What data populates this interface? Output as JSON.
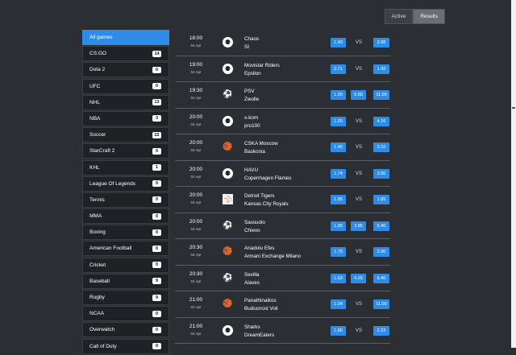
{
  "tabs": [
    {
      "label": "Active",
      "selected": false
    },
    {
      "label": "Results",
      "selected": true
    }
  ],
  "sidebar": [
    {
      "label": "All games",
      "count": "",
      "selected": true
    },
    {
      "label": "CS:GO",
      "count": "14"
    },
    {
      "label": "Dota 2",
      "count": "0"
    },
    {
      "label": "UFC",
      "count": "0"
    },
    {
      "label": "NHL",
      "count": "13"
    },
    {
      "label": "NBA",
      "count": "3"
    },
    {
      "label": "Soccer",
      "count": "22"
    },
    {
      "label": "StarCraft 2",
      "count": "0"
    },
    {
      "label": "KHL",
      "count": "1"
    },
    {
      "label": "League Of Legends",
      "count": "0"
    },
    {
      "label": "Tennis",
      "count": "0"
    },
    {
      "label": "MMA",
      "count": "0"
    },
    {
      "label": "Boxing",
      "count": "0"
    },
    {
      "label": "American Football",
      "count": "0"
    },
    {
      "label": "Cricket",
      "count": "0"
    },
    {
      "label": "Baseball",
      "count": "9"
    },
    {
      "label": "Rugby",
      "count": "9"
    },
    {
      "label": "NCAA",
      "count": "0"
    },
    {
      "label": "Overwatch",
      "count": "0"
    },
    {
      "label": "Call of Duty",
      "count": "0"
    }
  ],
  "matches": [
    {
      "time": "18:00",
      "date": "04 Apr",
      "icon": "cs-icon",
      "team1": "Chaos",
      "team2": "SI",
      "odd1": "1.43",
      "oddx": "",
      "odd2": "2.68"
    },
    {
      "time": "19:00",
      "date": "04 Apr",
      "icon": "cs-icon",
      "team1": "Movistar Riders",
      "team2": "Epsilon",
      "odd1": "2.71",
      "oddx": "",
      "odd2": "1.42"
    },
    {
      "time": "19:30",
      "date": "04 Apr",
      "icon": "soccer-icon",
      "team1": "PSV",
      "team2": "Zwolle",
      "odd1": "1.25",
      "oddx": "6.80",
      "odd2": "11.00"
    },
    {
      "time": "20:00",
      "date": "04 Apr",
      "icon": "cs-icon",
      "team1": "x-kom",
      "team2": "pro100",
      "odd1": "1.20",
      "oddx": "",
      "odd2": "4.16"
    },
    {
      "time": "20:00",
      "date": "04 Apr",
      "icon": "basketball-icon",
      "team1": "CSKA Moscow",
      "team2": "Baskonia",
      "odd1": "1.40",
      "oddx": "",
      "odd2": "3.10"
    },
    {
      "time": "20:00",
      "date": "04 Apr",
      "icon": "cs-icon",
      "team1": "HAVU",
      "team2": "Copenhagen Flames",
      "odd1": "1.74",
      "oddx": "",
      "odd2": "2.00"
    },
    {
      "time": "20:00",
      "date": "04 Apr",
      "icon": "baseball-icon",
      "team1": "Detroit Tigers",
      "team2": "Kansas City Royals",
      "odd1": "1.85",
      "oddx": "",
      "odd2": "1.85"
    },
    {
      "time": "20:00",
      "date": "04 Apr",
      "icon": "soccer-icon",
      "team1": "Sassuolo",
      "team2": "Chievo",
      "odd1": "1.85",
      "oddx": "3.85",
      "odd2": "5.40"
    },
    {
      "time": "20:30",
      "date": "04 Apr",
      "icon": "basketball-icon",
      "team1": "Anadolu Efes",
      "team2": "Armani Exchange Milano",
      "odd1": "1.70",
      "oddx": "",
      "odd2": "2.30"
    },
    {
      "time": "20:30",
      "date": "04 Apr",
      "icon": "soccer-icon",
      "team1": "Sevilla",
      "team2": "Alaves",
      "odd1": "1.52",
      "oddx": "4.25",
      "odd2": "6.40"
    },
    {
      "time": "21:00",
      "date": "04 Apr",
      "icon": "basketball-icon",
      "team1": "Panathinaikos",
      "team2": "Buducnost Voli",
      "odd1": "1.04",
      "oddx": "",
      "odd2": "11.00"
    },
    {
      "time": "21:00",
      "date": "04 Apr",
      "icon": "cs-icon",
      "team1": "Sharks",
      "team2": "DreamEaters",
      "odd1": "1.80",
      "oddx": "",
      "odd2": "2.23"
    }
  ],
  "vs_label": "VS"
}
